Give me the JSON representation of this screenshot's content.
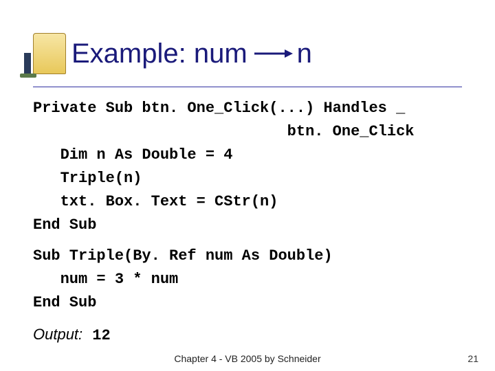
{
  "title": {
    "prefix": "Example: num",
    "suffix": "n"
  },
  "code": {
    "l1": "Private Sub btn. One_Click(...) Handles _",
    "l2": "                            btn. One_Click",
    "l3": "   Dim n As Double = 4",
    "l4": "   Triple(n)",
    "l5": "   txt. Box. Text = CStr(n)",
    "l6": "End Sub",
    "l7": "Sub Triple(By. Ref num As Double)",
    "l8": "   num = 3 * num",
    "l9": "End Sub"
  },
  "output": {
    "label": "Output:",
    "value": "12"
  },
  "footer": "Chapter 4 - VB 2005 by Schneider",
  "page": "21"
}
